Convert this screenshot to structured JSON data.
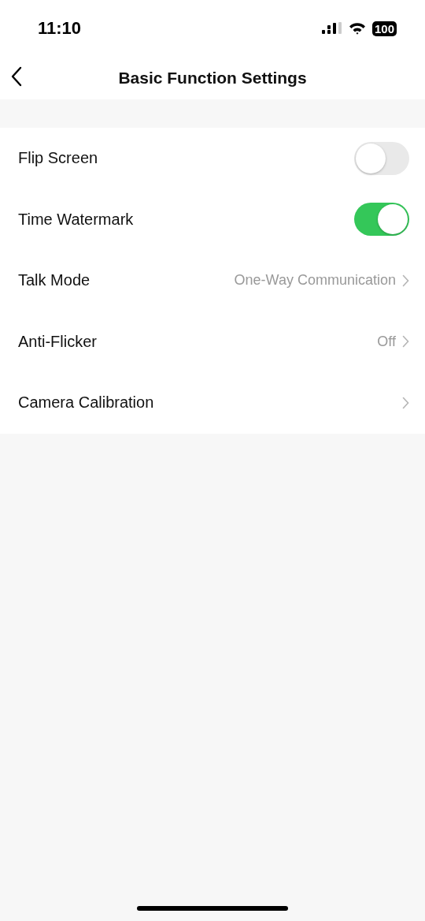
{
  "status_bar": {
    "time": "11:10",
    "battery": "100"
  },
  "header": {
    "title": "Basic Function Settings"
  },
  "rows": [
    {
      "kind": "toggle",
      "label": "Flip Screen",
      "on": false
    },
    {
      "kind": "toggle",
      "label": "Time Watermark",
      "on": true
    },
    {
      "kind": "link",
      "label": "Talk Mode",
      "value": "One-Way Communication"
    },
    {
      "kind": "link",
      "label": "Anti-Flicker",
      "value": "Off"
    },
    {
      "kind": "link",
      "label": "Camera Calibration"
    }
  ]
}
